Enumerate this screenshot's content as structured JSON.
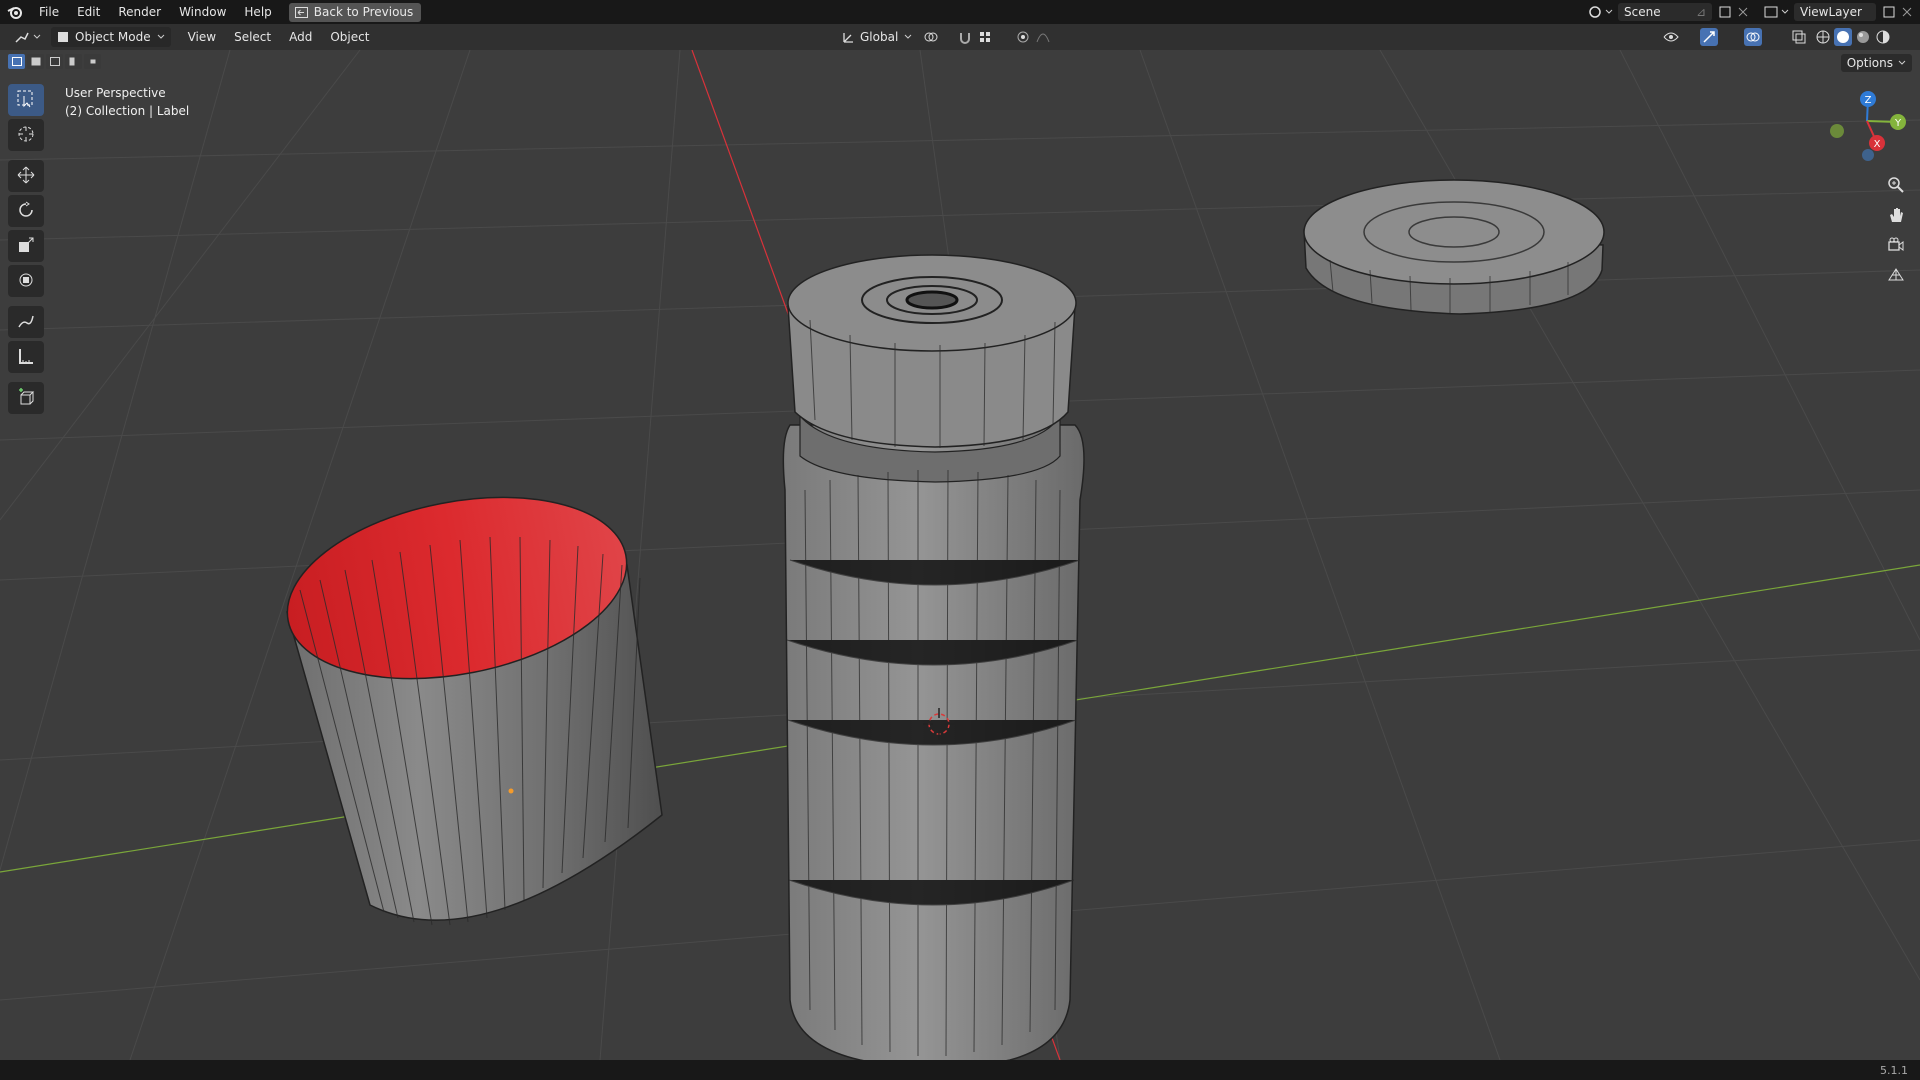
{
  "topbar": {
    "menu": [
      "File",
      "Edit",
      "Render",
      "Window",
      "Help"
    ],
    "back_button": "Back to Previous",
    "scene_field": "Scene",
    "viewlayer_field": "ViewLayer"
  },
  "header": {
    "mode": "Object Mode",
    "menus": [
      "View",
      "Select",
      "Add",
      "Object"
    ],
    "transform_orientation": "Global",
    "options_label": "Options"
  },
  "viewport": {
    "perspective_label": "User Perspective",
    "collection_label": "(2) Collection | Label"
  },
  "statusbar": {
    "version": "5.1.1"
  },
  "colors": {
    "background": "#3d3d3d",
    "grid": "#4a4a4a",
    "x_axis": "#d8323a",
    "y_axis": "#7aa63a",
    "mesh": "#7e7e7e",
    "inner_face": "#d4282c",
    "accent": "#4772b3"
  },
  "icons": [
    "blender-logo",
    "select-box-icon",
    "cursor-icon",
    "move-icon",
    "rotate-icon",
    "scale-icon",
    "transform-icon",
    "annotate-icon",
    "measure-icon",
    "add-cube-icon",
    "zoom-icon",
    "hand-icon",
    "camera-icon",
    "grid-icon"
  ]
}
